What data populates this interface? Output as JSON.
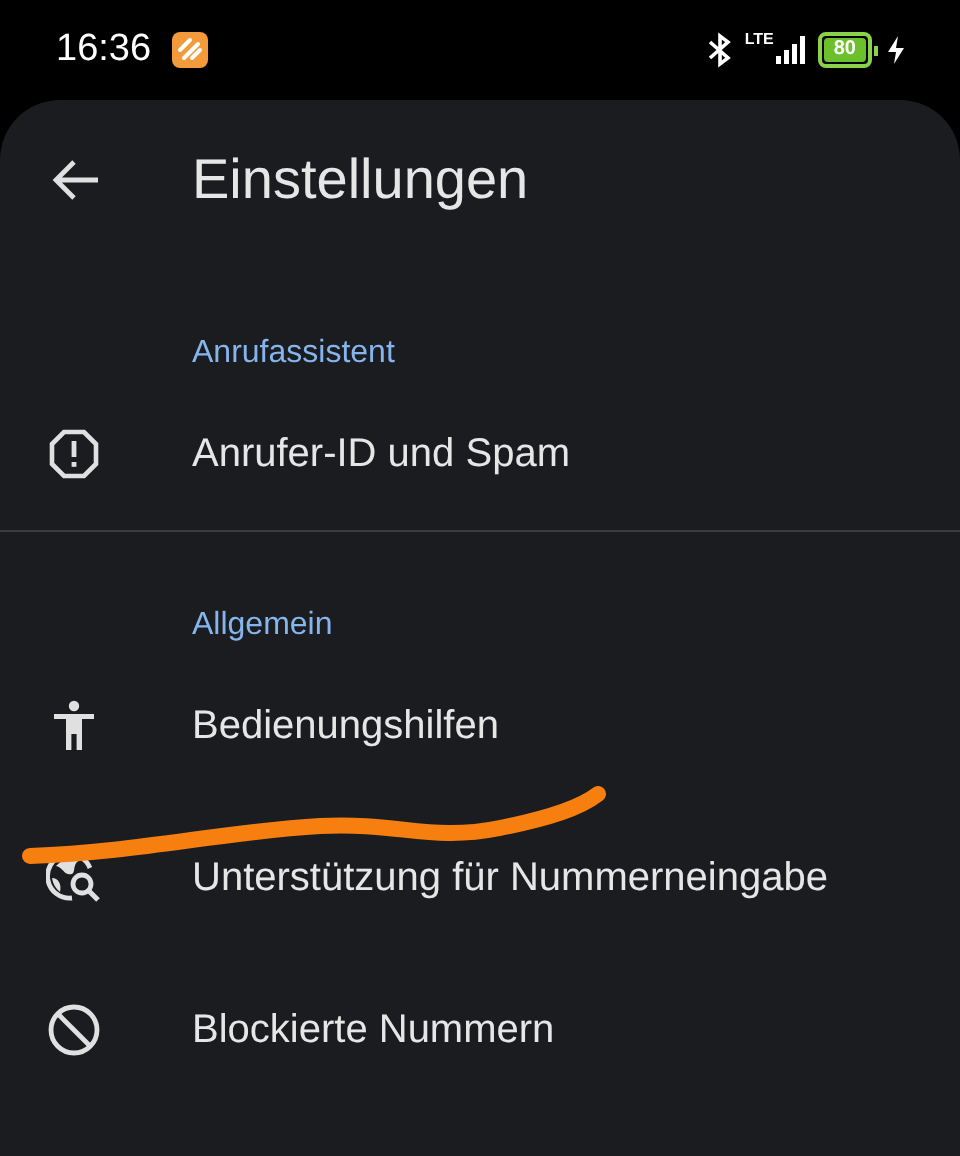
{
  "status_bar": {
    "time": "16:36",
    "network": "LTE",
    "battery": "80"
  },
  "header": {
    "title": "Einstellungen"
  },
  "sections": [
    {
      "title": "Anrufassistent",
      "items": [
        {
          "label": "Anrufer-ID und Spam",
          "kind": "alert"
        }
      ]
    },
    {
      "title": "Allgemein",
      "items": [
        {
          "label": "Bedienungshilfen",
          "kind": "accessibility"
        },
        {
          "label": "Unterstützung für Nummerneingabe",
          "kind": "globe-search"
        },
        {
          "label": "Blockierte Nummern",
          "kind": "block"
        }
      ]
    }
  ]
}
